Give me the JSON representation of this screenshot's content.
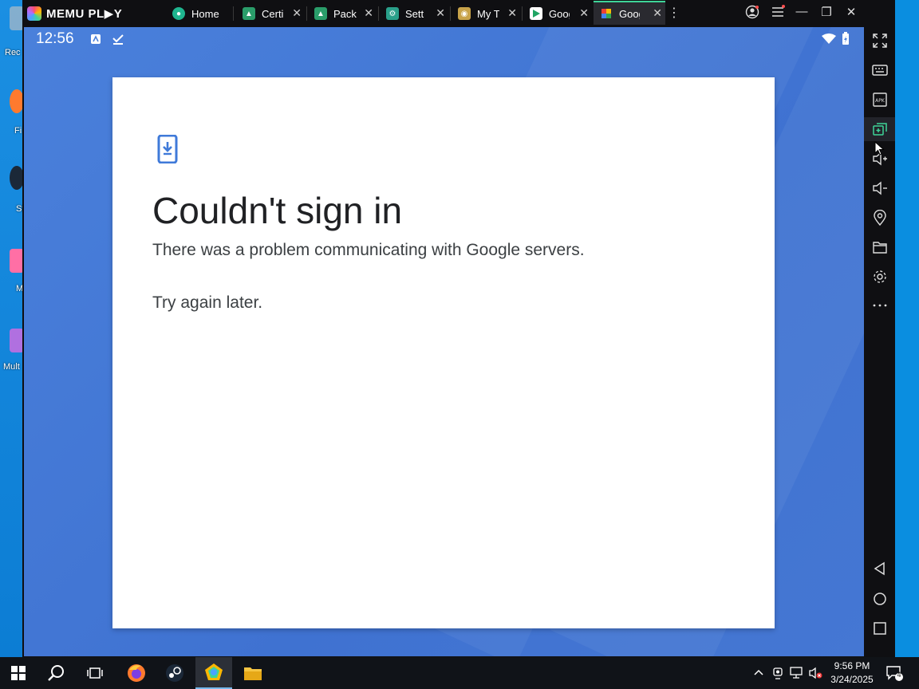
{
  "desktop": {
    "icons": [
      {
        "label": "Rec",
        "color": "#9fb7c9"
      },
      {
        "label": "Fi",
        "color": "#ff7a2e"
      },
      {
        "label": "St",
        "color": "#1b2838"
      },
      {
        "label": "M",
        "color": "#ff6fa5"
      },
      {
        "label": "Mult",
        "color": "#b070e0"
      }
    ]
  },
  "emulator": {
    "brand": "MEMU PL▶Y",
    "tabs": [
      {
        "label": "Home",
        "icon": "home-app-icon",
        "color": "#1fb58f"
      },
      {
        "label": "Certi",
        "icon": "android-icon",
        "color": "#2a9d6a"
      },
      {
        "label": "Pack",
        "icon": "android-icon",
        "color": "#2a9d6a"
      },
      {
        "label": "Setti",
        "icon": "settings-app-icon",
        "color": "#2aa08a"
      },
      {
        "label": "My T",
        "icon": "my-tom-icon",
        "color": "#c8a34a"
      },
      {
        "label": "Gooğ",
        "icon": "google-play-icon",
        "color": "#ffffff"
      },
      {
        "label": "Gooğ",
        "icon": "puzzle-icon",
        "color": "#3a3a3a"
      }
    ],
    "more_tabs": "⋮",
    "window_controls": {
      "minimize": "—",
      "restore": "❐",
      "close": "✕",
      "collapse": "«"
    }
  },
  "android": {
    "status": {
      "time": "12:56"
    },
    "dialog": {
      "title": "Couldn't sign in",
      "message": "There was a problem communicating with Google servers.",
      "hint": "Try again later."
    }
  },
  "sidebar_tools": [
    {
      "name": "fullscreen-icon"
    },
    {
      "name": "keyboard-icon"
    },
    {
      "name": "apk-install-icon"
    },
    {
      "name": "multi-instance-icon"
    },
    {
      "name": "volume-up-icon"
    },
    {
      "name": "volume-down-icon"
    },
    {
      "name": "location-icon"
    },
    {
      "name": "folder-icon"
    },
    {
      "name": "settings-icon"
    },
    {
      "name": "more-icon"
    }
  ],
  "nav": [
    "back-icon",
    "home-icon",
    "recents-icon"
  ],
  "taskbar": {
    "time": "9:56 PM",
    "date": "3/24/2025",
    "notifications": "4"
  },
  "colors": {
    "dialog_icon": "#3f7ad9",
    "active_tab_accent": "#3ed598",
    "screen_bg": "#4a80db"
  }
}
